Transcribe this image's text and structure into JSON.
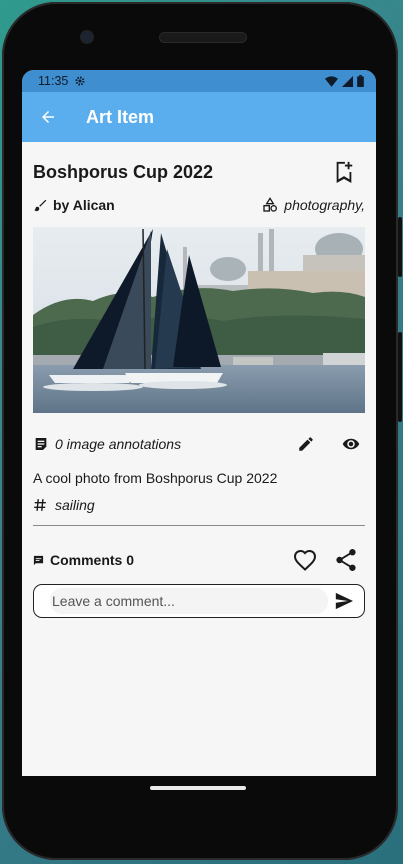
{
  "status_bar": {
    "time": "11:35"
  },
  "app_bar": {
    "title": "Art Item"
  },
  "item": {
    "title": "Boshporus Cup 2022",
    "author": "by Alican",
    "category": "photography,",
    "annotations": "0 image annotations",
    "description": "A cool photo from Boshporus Cup 2022",
    "tag": "sailing"
  },
  "comments": {
    "label": "Comments 0",
    "placeholder": "Leave a comment..."
  },
  "icons": {
    "back": "arrow-left",
    "bookmark": "bookmark-add",
    "author": "brush",
    "category": "shapes",
    "annotations": "notes",
    "edit": "pencil",
    "view": "eye",
    "tag": "hash",
    "comments": "chat-bubble",
    "like": "heart-outline",
    "share": "share",
    "send": "send"
  },
  "colors": {
    "status_bar": "#3f8fd0",
    "app_bar": "#5aaeee",
    "background": "#f6f6f6"
  }
}
